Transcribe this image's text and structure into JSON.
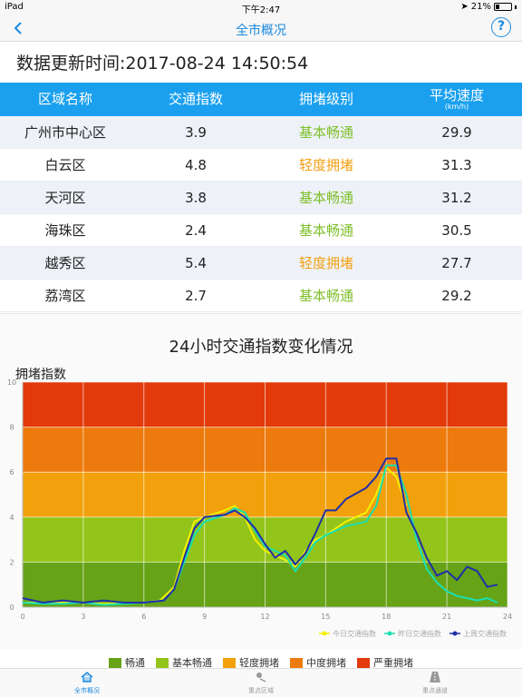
{
  "status": {
    "device": "iPad",
    "time": "下午2:47",
    "battery": "21%",
    "battery_level": 0.21
  },
  "nav": {
    "title": "全市概况",
    "help": "?"
  },
  "update": {
    "label": "数据更新时间:",
    "value": "2017-08-24 14:50:54"
  },
  "table": {
    "headers": [
      "区域名称",
      "交通指数",
      "拥堵级别",
      "平均速度"
    ],
    "speed_unit": "(km/h)",
    "rows": [
      {
        "area": "广州市中心区",
        "index": "3.9",
        "level": "基本畅通",
        "speed": "29.9"
      },
      {
        "area": "白云区",
        "index": "4.8",
        "level": "轻度拥堵",
        "speed": "31.3"
      },
      {
        "area": "天河区",
        "index": "3.8",
        "level": "基本畅通",
        "speed": "31.2"
      },
      {
        "area": "海珠区",
        "index": "2.4",
        "level": "基本畅通",
        "speed": "30.5"
      },
      {
        "area": "越秀区",
        "index": "5.4",
        "level": "轻度拥堵",
        "speed": "27.7"
      },
      {
        "area": "荔湾区",
        "index": "2.7",
        "level": "基本畅通",
        "speed": "29.2"
      }
    ]
  },
  "chart_data": {
    "type": "line",
    "title": "24小时交通指数变化情况",
    "ylabel": "拥堵指数",
    "xlabel": "",
    "xlim": [
      0,
      24
    ],
    "ylim": [
      0,
      10
    ],
    "x_ticks": [
      "0",
      "3",
      "6",
      "9",
      "12",
      "15",
      "18",
      "21",
      "24"
    ],
    "y_ticks": [
      "0",
      "2",
      "4",
      "6",
      "8",
      "10"
    ],
    "bands": [
      {
        "from": 0,
        "to": 2,
        "color": "#66a317"
      },
      {
        "from": 2,
        "to": 4,
        "color": "#93c41a"
      },
      {
        "from": 4,
        "to": 6,
        "color": "#f2a10c"
      },
      {
        "from": 6,
        "to": 8,
        "color": "#ed7a0c"
      },
      {
        "from": 8,
        "to": 10,
        "color": "#e23a0a"
      }
    ],
    "series": [
      {
        "name": "今日交通指数",
        "color": "#f4f100",
        "x": [
          0,
          1,
          2,
          3,
          4,
          5,
          6,
          6.8,
          7.5,
          8,
          8.5,
          9,
          10,
          10.5,
          11,
          11.5,
          12,
          12.5,
          13,
          13.5,
          14,
          14.5,
          15,
          16,
          17,
          17.5,
          18,
          18.5,
          19
        ],
        "y": [
          0.2,
          0.2,
          0.2,
          0.2,
          0.15,
          0.2,
          0.2,
          0.3,
          0.9,
          2.5,
          3.8,
          4.0,
          4.3,
          4.5,
          4.0,
          3.0,
          2.5,
          2.3,
          2.1,
          1.8,
          2.5,
          3.0,
          3.2,
          3.8,
          4.2,
          5.0,
          6.2,
          5.8,
          4.5
        ]
      },
      {
        "name": "昨日交通指数",
        "color": "#18e0b0",
        "x": [
          0,
          1,
          2,
          3,
          4,
          5,
          6,
          7,
          7.5,
          8,
          8.5,
          9,
          10,
          10.5,
          11,
          11.5,
          12,
          12.5,
          13,
          13.5,
          14,
          14.5,
          15,
          16,
          17,
          17.5,
          18,
          18.5,
          19,
          19.5,
          20,
          20.5,
          21,
          21.5,
          22,
          22.5,
          23,
          23.5
        ],
        "y": [
          0.2,
          0.15,
          0.15,
          0.2,
          0.1,
          0.15,
          0.2,
          0.3,
          0.8,
          2.0,
          3.2,
          3.8,
          4.1,
          4.4,
          4.2,
          3.4,
          2.7,
          2.5,
          2.3,
          1.6,
          2.2,
          2.9,
          3.2,
          3.6,
          3.8,
          4.5,
          6.3,
          6.3,
          5.0,
          3.0,
          1.7,
          1.1,
          0.7,
          0.5,
          0.4,
          0.3,
          0.4,
          0.2
        ]
      },
      {
        "name": "上周交通指数",
        "color": "#1f2fa8",
        "x": [
          0,
          1,
          2,
          3,
          4,
          5,
          6,
          7,
          7.5,
          8,
          8.5,
          9,
          10,
          10.5,
          11,
          11.5,
          12,
          12.5,
          13,
          13.5,
          14,
          14.5,
          15,
          15.5,
          16,
          17,
          17.5,
          18,
          18.5,
          19,
          19.5,
          20,
          20.5,
          21,
          21.5,
          22,
          22.5,
          23,
          23.5
        ],
        "y": [
          0.4,
          0.2,
          0.3,
          0.2,
          0.3,
          0.2,
          0.2,
          0.3,
          0.8,
          2.2,
          3.5,
          4.0,
          4.1,
          4.3,
          4.0,
          3.5,
          2.8,
          2.2,
          2.5,
          1.9,
          2.4,
          3.3,
          4.3,
          4.3,
          4.8,
          5.3,
          5.8,
          6.6,
          6.6,
          4.2,
          3.3,
          2.2,
          1.4,
          1.6,
          1.2,
          1.8,
          1.6,
          0.9,
          1.0
        ]
      }
    ],
    "bottom_legend": [
      {
        "label": "畅通",
        "color": "#66a317"
      },
      {
        "label": "基本畅通",
        "color": "#93c41a"
      },
      {
        "label": "轻度拥堵",
        "color": "#f2a10c"
      },
      {
        "label": "中度拥堵",
        "color": "#ed7a0c"
      },
      {
        "label": "严重拥堵",
        "color": "#e23a0a"
      }
    ]
  },
  "tabs": [
    {
      "label": "全市概况",
      "icon": "home-icon",
      "active": true
    },
    {
      "label": "重点区域",
      "icon": "location-pin-icon",
      "active": false
    },
    {
      "label": "重点通道",
      "icon": "road-icon",
      "active": false
    }
  ]
}
